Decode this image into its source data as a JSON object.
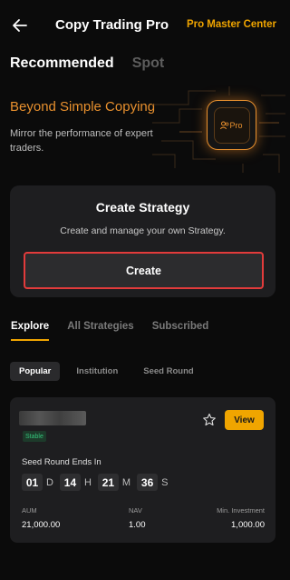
{
  "header": {
    "title": "Copy Trading Pro",
    "pro_link": "Pro Master Center"
  },
  "top_tabs": [
    {
      "label": "Recommended",
      "active": true
    },
    {
      "label": "Spot",
      "active": false
    }
  ],
  "banner": {
    "title": "Beyond Simple Copying",
    "subtitle": "Mirror the performance of expert traders.",
    "badge_text": "Pro"
  },
  "create_card": {
    "title": "Create Strategy",
    "subtitle": "Create and manage your own Strategy.",
    "button_label": "Create"
  },
  "explore_tabs": [
    {
      "label": "Explore",
      "active": true
    },
    {
      "label": "All Strategies",
      "active": false
    },
    {
      "label": "Subscribed",
      "active": false
    }
  ],
  "filters": [
    {
      "label": "Popular",
      "active": true
    },
    {
      "label": "Institution",
      "active": false
    },
    {
      "label": "Seed Round",
      "active": false
    }
  ],
  "strategy_card": {
    "badge": "Stable",
    "view_label": "View",
    "seed_label": "Seed Round Ends In",
    "countdown": {
      "days": "01",
      "days_unit": "D",
      "hours": "14",
      "hours_unit": "H",
      "minutes": "21",
      "minutes_unit": "M",
      "seconds": "36",
      "seconds_unit": "S"
    },
    "aum_label": "AUM",
    "aum_value": "21,000.00",
    "nav_label": "NAV",
    "nav_value": "1.00",
    "min_label": "Min. Investment",
    "min_value": "1,000.00"
  },
  "colors": {
    "accent": "#f0a500",
    "banner_title": "#e8902e",
    "create_border": "#e23b3b",
    "stable_text": "#34c27a"
  }
}
